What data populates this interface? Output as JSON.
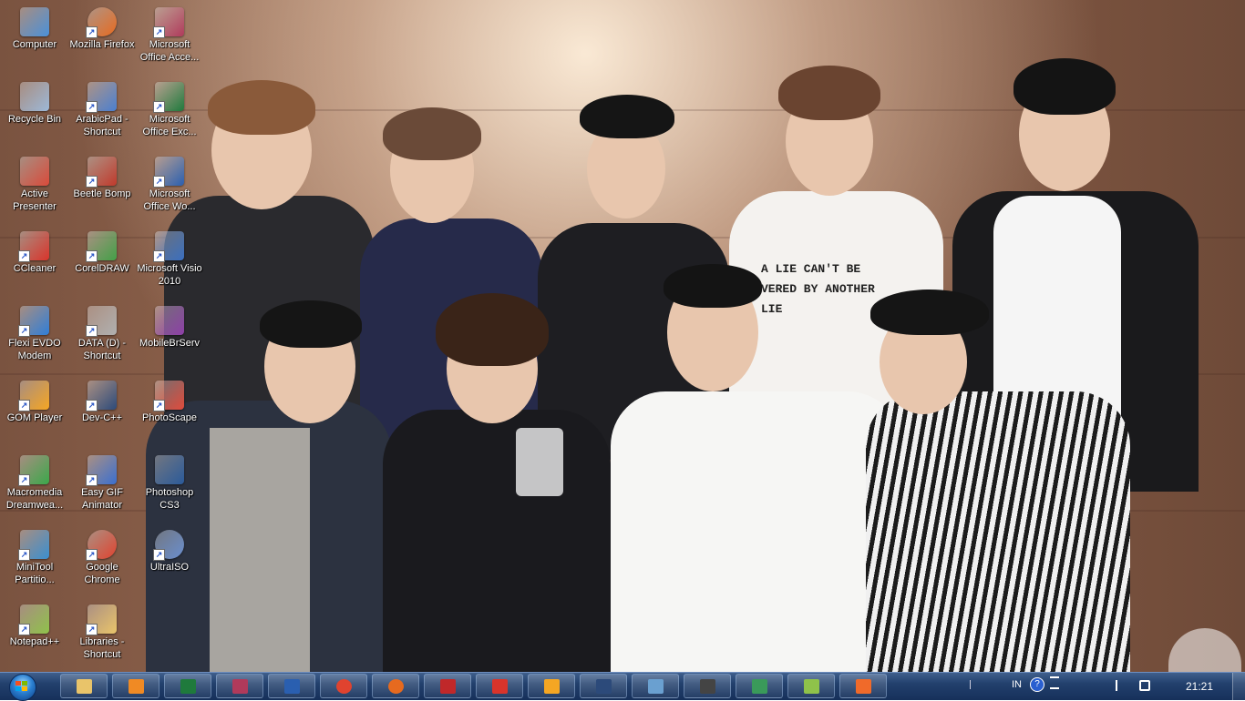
{
  "desktop": {
    "icons": [
      {
        "label": "Computer",
        "icon": "computer-icon",
        "color": "#4a90d9"
      },
      {
        "label": "Recycle Bin",
        "icon": "recycle-bin-icon",
        "color": "#9db8d8"
      },
      {
        "label": "Active Presenter",
        "icon": "active-presenter-icon",
        "color": "#d94a3a"
      },
      {
        "label": "CCleaner",
        "icon": "ccleaner-icon",
        "color": "#d9342b"
      },
      {
        "label": "Flexi EVDO Modem",
        "icon": "modem-icon",
        "color": "#2f7ed8"
      },
      {
        "label": "GOM Player",
        "icon": "gom-player-icon",
        "color": "#f5a623"
      },
      {
        "label": "Macromedia Dreamwea...",
        "icon": "dreamweaver-icon",
        "color": "#3aa84a"
      },
      {
        "label": "MiniTool Partitio...",
        "icon": "minitool-icon",
        "color": "#3a8fd0"
      },
      {
        "label": "Notepad++",
        "icon": "notepadpp-icon",
        "color": "#8fc24a"
      },
      {
        "label": "Mozilla Firefox",
        "icon": "firefox-icon",
        "color": "#e66a1f"
      },
      {
        "label": "ArabicPad - Shortcut",
        "icon": "arabicpad-icon",
        "color": "#4a7fd0"
      },
      {
        "label": "Beetle Bomp",
        "icon": "beetle-bomp-icon",
        "color": "#c0392b"
      },
      {
        "label": "CorelDRAW",
        "icon": "coreldraw-icon",
        "color": "#43a047"
      },
      {
        "label": "DATA (D) - Shortcut",
        "icon": "drive-icon",
        "color": "#b0b0b0"
      },
      {
        "label": "Dev-C++",
        "icon": "devcpp-icon",
        "color": "#2c4a7a"
      },
      {
        "label": "Easy GIF Animator",
        "icon": "easy-gif-icon",
        "color": "#3a6fd0"
      },
      {
        "label": "Google Chrome",
        "icon": "chrome-icon",
        "color": "#e0432f"
      },
      {
        "label": "Libraries - Shortcut",
        "icon": "libraries-icon",
        "color": "#e9c46a"
      },
      {
        "label": "Microsoft Office Acce...",
        "icon": "access-icon",
        "color": "#b03a5b"
      },
      {
        "label": "Microsoft Office Exc...",
        "icon": "excel-icon",
        "color": "#1f7a3c"
      },
      {
        "label": "Microsoft Office Wo...",
        "icon": "word-icon",
        "color": "#2a5fb0"
      },
      {
        "label": "Microsoft Visio 2010",
        "icon": "visio-icon",
        "color": "#3a6fc0"
      },
      {
        "label": "MobileBrServ",
        "icon": "winrar-icon",
        "color": "#8e3fa8"
      },
      {
        "label": "PhotoScape",
        "icon": "photoscape-icon",
        "color": "#e04a3a"
      },
      {
        "label": "Photoshop CS3",
        "icon": "photoshop-icon",
        "color": "#2a5a9a"
      },
      {
        "label": "UltraISO",
        "icon": "ultraiso-icon",
        "color": "#6a8fd0"
      }
    ]
  },
  "wallpaper": {
    "shirt_text": "A LIE CAN'T BE\nVERED BY ANOTHER LIE"
  },
  "taskbar": {
    "start_icon": "windows-start-orb-icon",
    "pinned": [
      {
        "name": "explorer",
        "icon": "folder-icon",
        "color": "#e9c46a"
      },
      {
        "name": "media-player",
        "icon": "media-player-icon",
        "color": "#f08a24"
      },
      {
        "name": "excel",
        "icon": "excel-icon",
        "color": "#1f7a3c"
      },
      {
        "name": "access",
        "icon": "access-icon",
        "color": "#b03a5b"
      },
      {
        "name": "word",
        "icon": "word-icon",
        "color": "#2a5fb0"
      },
      {
        "name": "chrome",
        "icon": "chrome-icon",
        "color": "#e0432f"
      },
      {
        "name": "firefox",
        "icon": "firefox-icon",
        "color": "#e66a1f"
      },
      {
        "name": "acrobat",
        "icon": "acrobat-icon",
        "color": "#c0282a"
      },
      {
        "name": "cleaner",
        "icon": "ccleaner-icon",
        "color": "#d9342b"
      },
      {
        "name": "gom",
        "icon": "gom-player-icon",
        "color": "#f5a623"
      },
      {
        "name": "devcpp",
        "icon": "devcpp-icon",
        "color": "#2c4a7a"
      },
      {
        "name": "paint",
        "icon": "paint-icon",
        "color": "#6aa0d0"
      },
      {
        "name": "clapper",
        "icon": "movie-maker-icon",
        "color": "#444444"
      },
      {
        "name": "network",
        "icon": "network-icon",
        "color": "#3a9a5a"
      },
      {
        "name": "notepadpp",
        "icon": "notepadpp-icon",
        "color": "#8fc24a"
      },
      {
        "name": "xampp",
        "icon": "xampp-icon",
        "color": "#f06a2a"
      }
    ],
    "tray": {
      "language": "IN",
      "time": "21:21"
    }
  }
}
